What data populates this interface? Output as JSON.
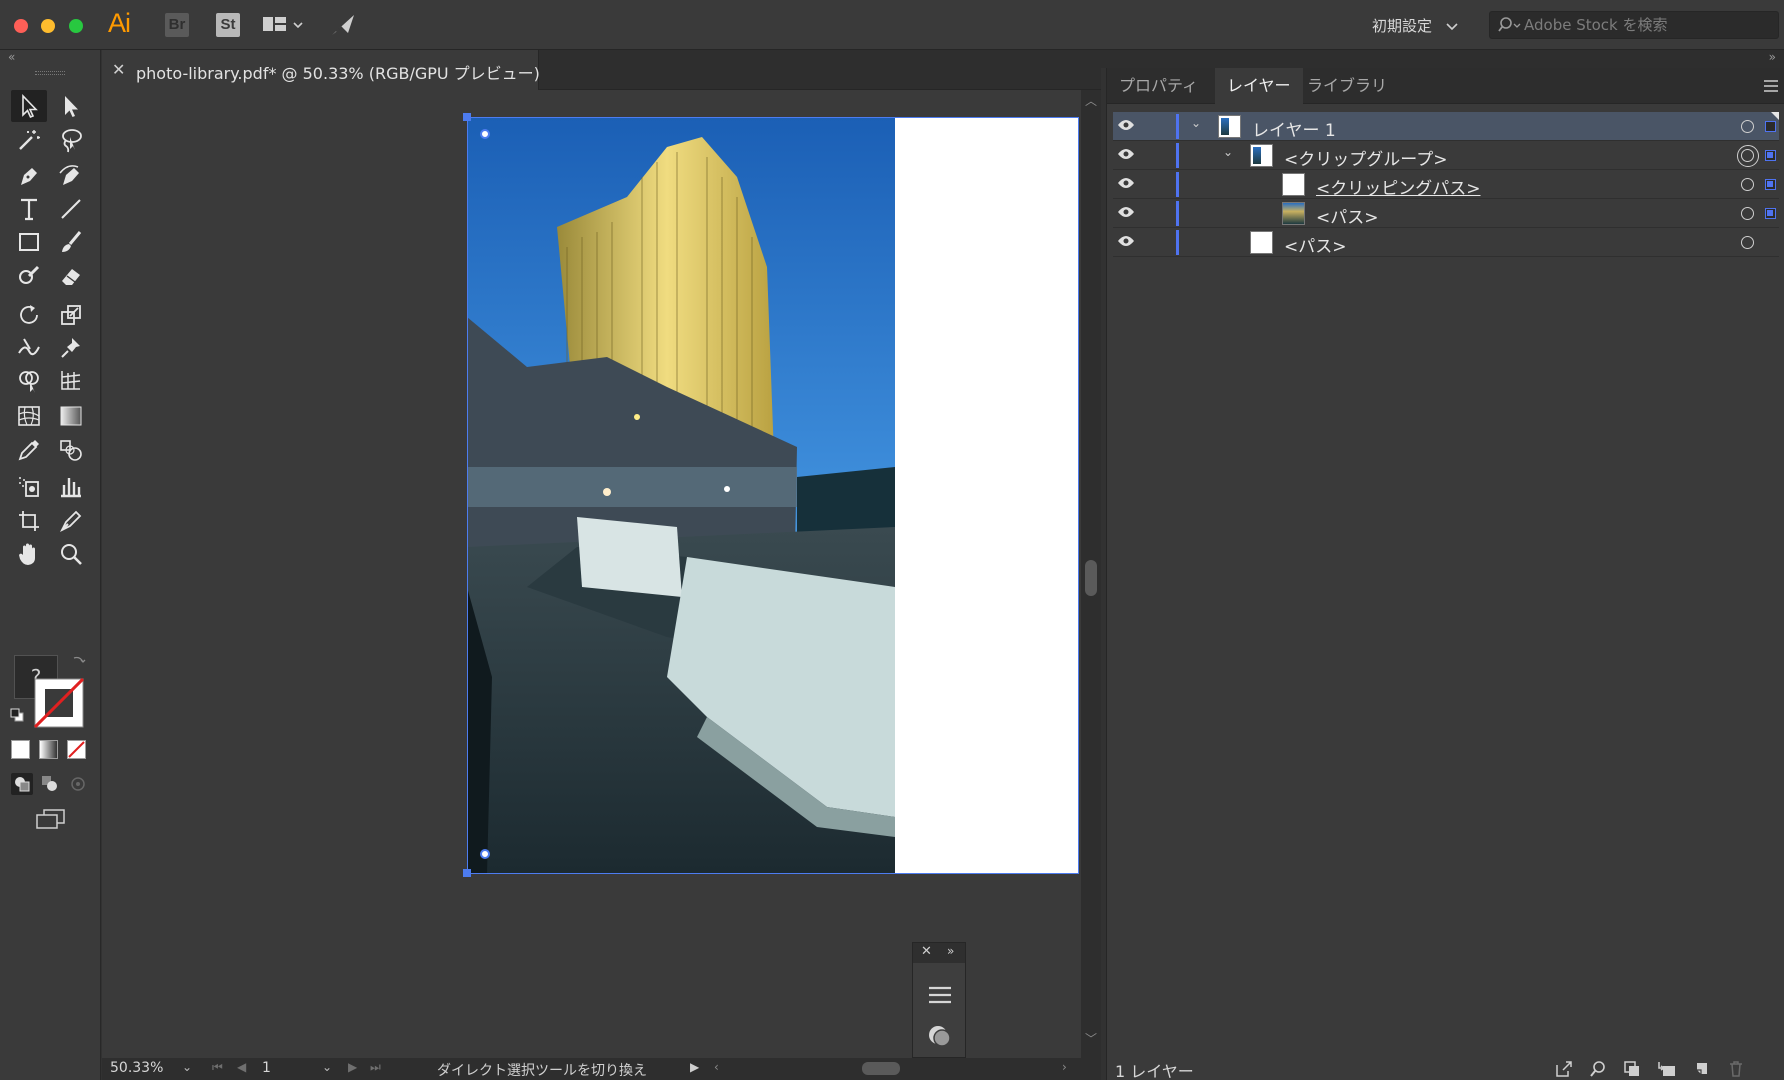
{
  "app": {
    "logo": "Ai",
    "bridge_chip": "Br",
    "stock_chip": "St",
    "workspace": "初期設定",
    "search": {
      "placeholder": "Adobe Stock を検索",
      "value": ""
    }
  },
  "document": {
    "tab_title": "photo-library.pdf* @ 50.33% (RGB/GPU プレビュー)",
    "close_glyph": "✕"
  },
  "status_bar": {
    "zoom": "50.33%",
    "page": "1",
    "status_text": "ダイレクト選択ツールを切り換え"
  },
  "toolbar": {
    "unknown_label": "?"
  },
  "right_panel": {
    "tabs": [
      {
        "label": "プロパティ",
        "active": false
      },
      {
        "label": "レイヤー",
        "active": true
      },
      {
        "label": "ライブラリ",
        "active": false
      }
    ],
    "layers": [
      {
        "name": "レイヤー 1",
        "level": 0,
        "expanded": true,
        "selected": true,
        "thumb": "photo"
      },
      {
        "name": "<クリップグループ>",
        "level": 1,
        "expanded": true,
        "selected": false,
        "thumb": "photo"
      },
      {
        "name": "<クリッピングパス>",
        "level": 2,
        "selected": false,
        "thumb": "white",
        "underlined": true
      },
      {
        "name": "<パス>",
        "level": 2,
        "selected": false,
        "thumb": "photo"
      },
      {
        "name": "<パス>",
        "level": 1,
        "selected": false,
        "thumb": "white"
      }
    ],
    "layer_count": "1 レイヤー"
  },
  "colors": {
    "accent": "#4f73f0",
    "logo": "#ff9a00",
    "panel_bg": "#3a3a3a",
    "selected_row": "#4a5566"
  },
  "icons": [
    "close-icon",
    "chevron-down-icon",
    "eye-icon",
    "search-icon",
    "panel-menu-icon",
    "trash-icon",
    "new-layer-icon",
    "export-icon",
    "locate-icon",
    "clipping-mask-icon",
    "collect-icon"
  ]
}
